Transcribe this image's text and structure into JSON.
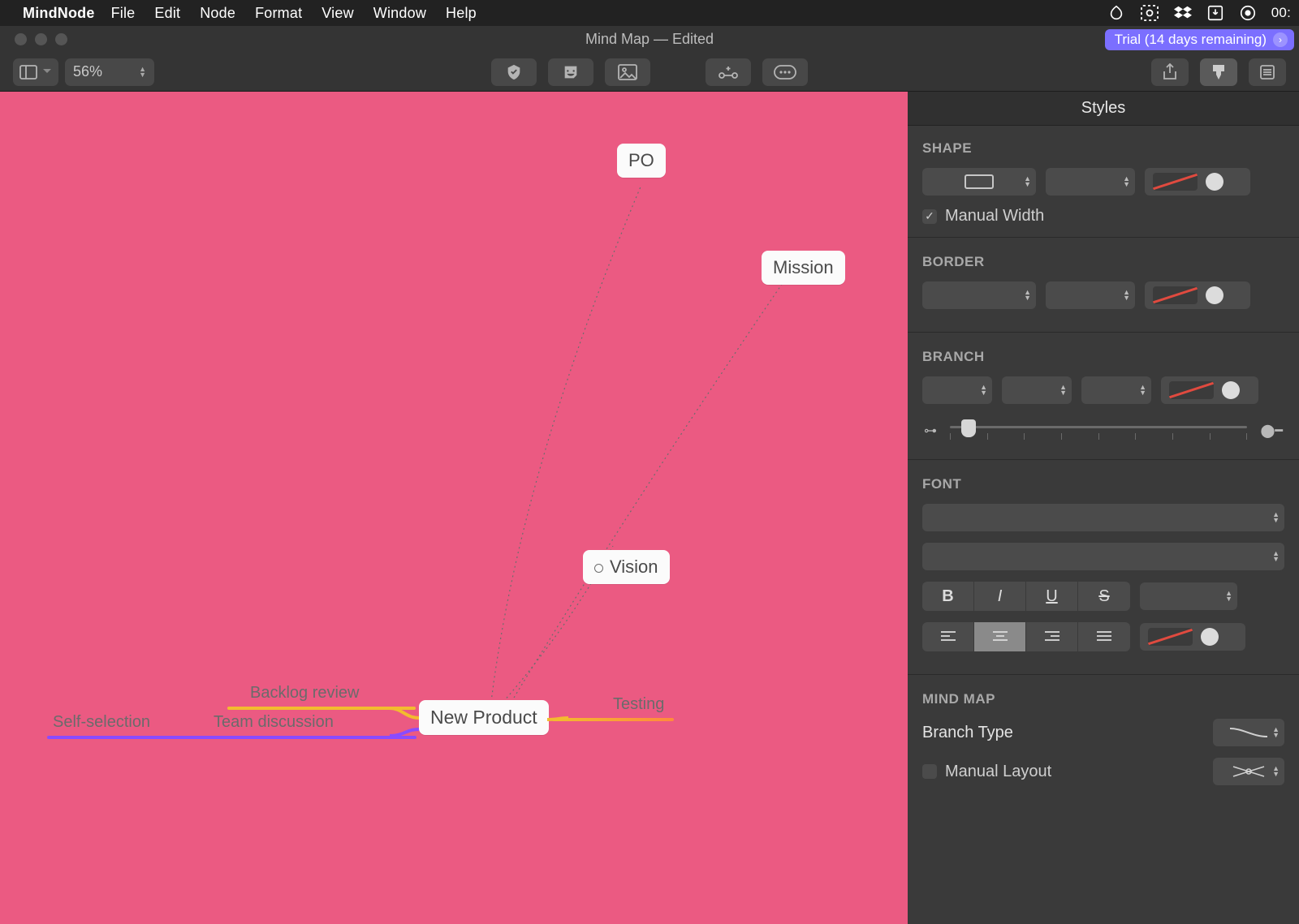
{
  "menubar": {
    "app_name": "MindNode",
    "items": [
      "File",
      "Edit",
      "Node",
      "Format",
      "View",
      "Window",
      "Help"
    ],
    "clock": "00:"
  },
  "window": {
    "title": "Mind Map — Edited",
    "trial_label": "Trial (14 days remaining)"
  },
  "toolbar": {
    "zoom": "56%"
  },
  "canvas": {
    "nodes": {
      "root": "New Product",
      "po": "PO",
      "mission": "Mission",
      "vision": "Vision"
    },
    "branches": {
      "backlog": "Backlog review",
      "team": "Team discussion",
      "self": "Self-selection",
      "testing": "Testing"
    }
  },
  "inspector": {
    "title": "Styles",
    "sections": {
      "shape": "SHAPE",
      "border": "BORDER",
      "branch": "BRANCH",
      "font": "FONT",
      "mindmap": "MIND MAP"
    },
    "manual_width": "Manual Width",
    "branch_type_label": "Branch Type",
    "manual_layout": "Manual Layout"
  }
}
